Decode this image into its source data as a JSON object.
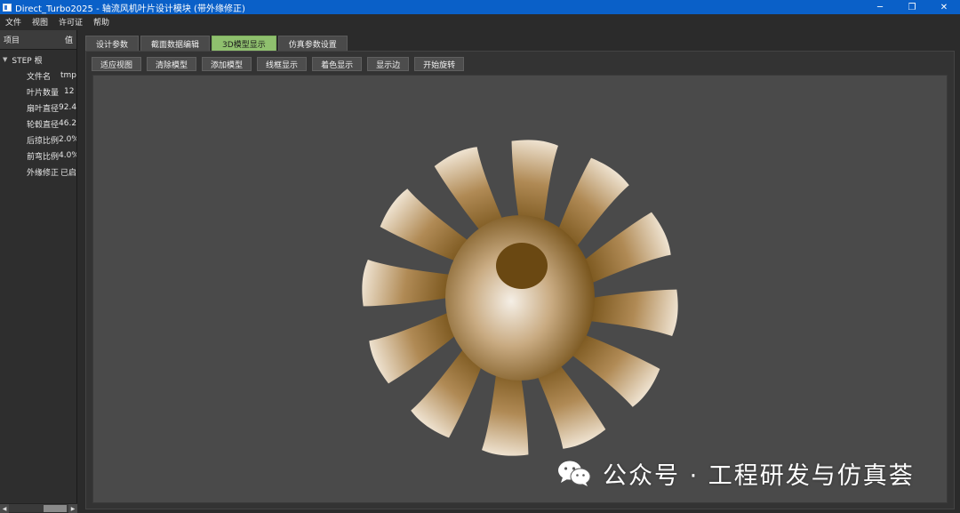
{
  "window": {
    "title": "Direct_Turbo2025 - 轴流风机叶片设计模块 (带外缘修正)",
    "controls": [
      "─",
      "❐",
      "✕"
    ]
  },
  "menu": [
    "文件",
    "视图",
    "许可证",
    "帮助"
  ],
  "tree": {
    "header_item": "项目",
    "header_value": "值",
    "root_label": "STEP 根",
    "rows": [
      {
        "key": "文件名",
        "value": "tmp"
      },
      {
        "key": "叶片数量",
        "value": "12"
      },
      {
        "key": "扇叶直径",
        "value": "92.4"
      },
      {
        "key": "轮毂直径",
        "value": "46.2"
      },
      {
        "key": "后掠比例",
        "value": "2.0%"
      },
      {
        "key": "前弯比例",
        "value": "4.0%"
      },
      {
        "key": "外缘修正",
        "value": "已启"
      }
    ]
  },
  "tabs": [
    {
      "label": "设计参数",
      "active": false
    },
    {
      "label": "截面数据编辑",
      "active": false
    },
    {
      "label": "3D模型显示",
      "active": true
    },
    {
      "label": "仿真参数设置",
      "active": false
    }
  ],
  "toolbar": [
    "适应视图",
    "清除模型",
    "添加模型",
    "线框显示",
    "着色显示",
    "显示边",
    "开始旋转"
  ],
  "model": {
    "blade_count": 12,
    "color": "#9c7438",
    "background": "#4a4a4a"
  },
  "watermark": {
    "text": "公众号 · 工程研发与仿真荟",
    "icon": "wechat-icon"
  },
  "colors": {
    "titlebar": "#0a60c8",
    "active_tab": "#8fc06e"
  }
}
